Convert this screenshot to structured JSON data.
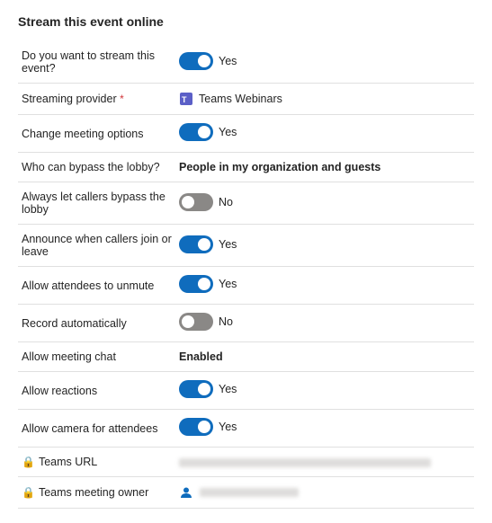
{
  "page": {
    "title": "Stream this event online"
  },
  "settings": [
    {
      "id": "stream-event",
      "label": "Do you want to stream this event?",
      "type": "toggle",
      "state": "on",
      "value_label": "Yes",
      "required": false
    },
    {
      "id": "streaming-provider",
      "label": "Streaming provider",
      "type": "provider",
      "provider_name": "Teams Webinars",
      "required": true
    },
    {
      "id": "change-meeting-options",
      "label": "Change meeting options",
      "type": "toggle",
      "state": "on",
      "value_label": "Yes",
      "required": false
    },
    {
      "id": "bypass-lobby",
      "label": "Who can bypass the lobby?",
      "type": "bold-text",
      "value_label": "People in my organization and guests",
      "required": false
    },
    {
      "id": "callers-bypass-lobby",
      "label": "Always let callers bypass the lobby",
      "type": "toggle",
      "state": "off",
      "value_label": "No",
      "required": false
    },
    {
      "id": "announce-callers",
      "label": "Announce when callers join or leave",
      "type": "toggle",
      "state": "on",
      "value_label": "Yes",
      "required": false
    },
    {
      "id": "allow-unmute",
      "label": "Allow attendees to unmute",
      "type": "toggle",
      "state": "on",
      "value_label": "Yes",
      "required": false
    },
    {
      "id": "record-automatically",
      "label": "Record automatically",
      "type": "toggle",
      "state": "off",
      "value_label": "No",
      "required": false
    },
    {
      "id": "meeting-chat",
      "label": "Allow meeting chat",
      "type": "bold-text",
      "value_label": "Enabled",
      "required": false
    },
    {
      "id": "allow-reactions",
      "label": "Allow reactions",
      "type": "toggle",
      "state": "on",
      "value_label": "Yes",
      "required": false
    },
    {
      "id": "allow-camera",
      "label": "Allow camera for attendees",
      "type": "toggle",
      "state": "on",
      "value_label": "Yes",
      "required": false
    },
    {
      "id": "teams-url",
      "label": "Teams URL",
      "type": "blurred-long",
      "locked": true
    },
    {
      "id": "teams-owner",
      "label": "Teams meeting owner",
      "type": "blurred-person",
      "locked": true
    }
  ],
  "icons": {
    "teams_webinar": "⊞",
    "lock": "🔒",
    "person": "👤"
  },
  "colors": {
    "toggle_on": "#0f6cbd",
    "toggle_off": "#8a8886",
    "accent_blue": "#0f6cbd",
    "border": "#e0e0e0",
    "text_main": "#242424",
    "text_muted": "#605e5c"
  }
}
